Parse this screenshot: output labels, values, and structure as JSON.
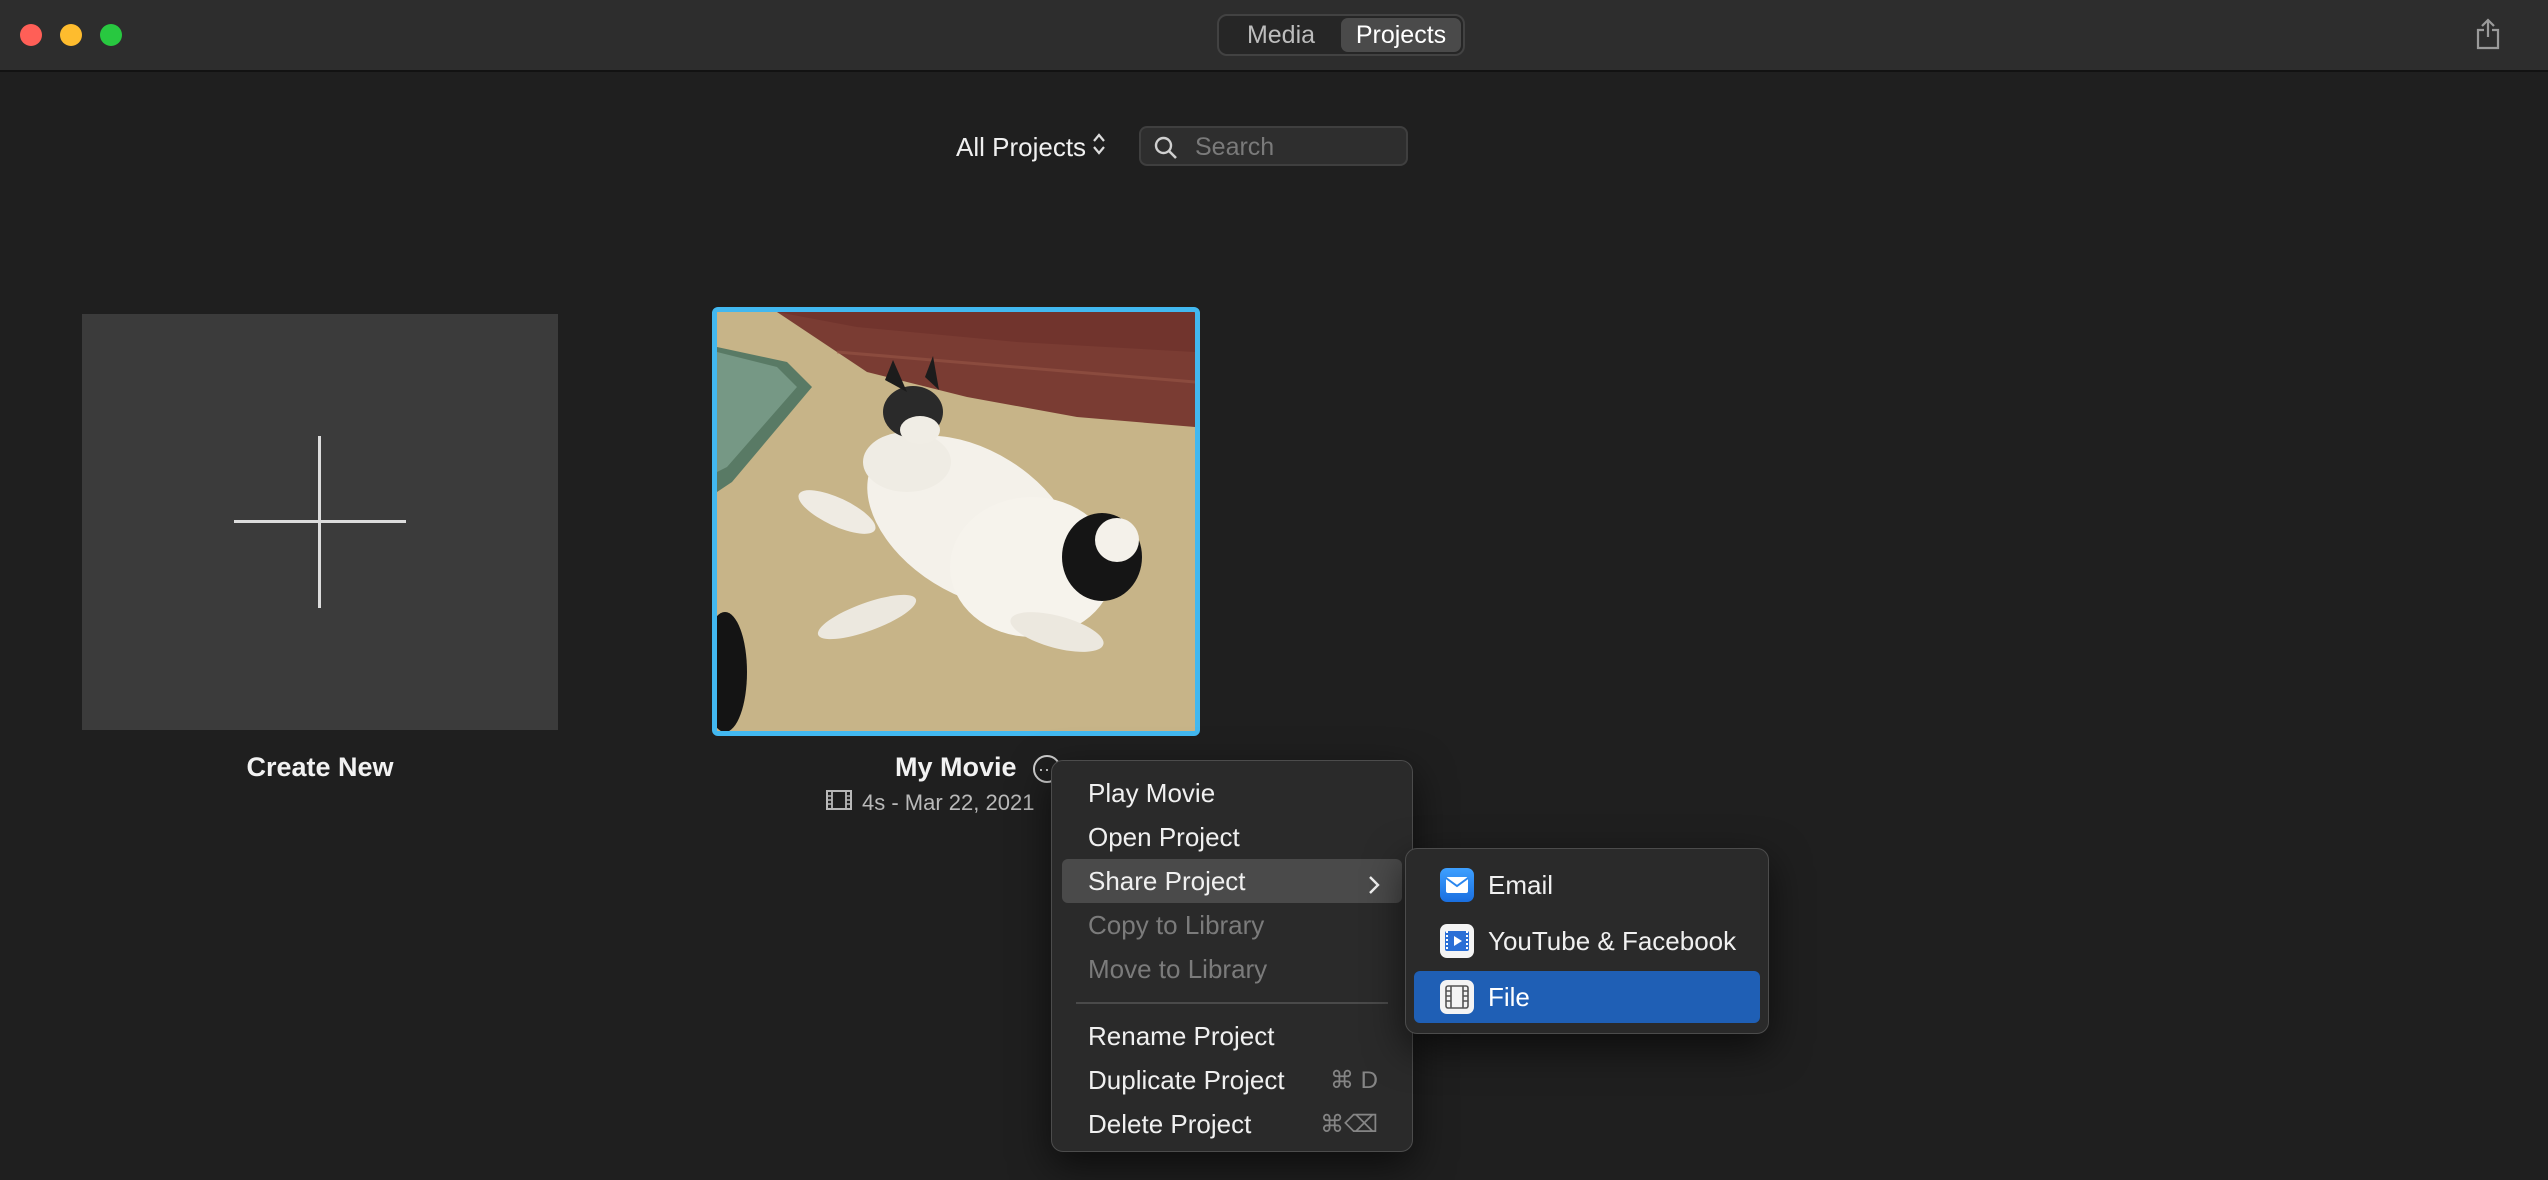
{
  "titlebar": {
    "tabs": [
      {
        "label": "Media",
        "active": false
      },
      {
        "label": "Projects",
        "active": true
      }
    ]
  },
  "toolbar": {
    "filter_label": "All Projects",
    "search_placeholder": "Search"
  },
  "projects": {
    "create_new_label": "Create New",
    "movie": {
      "title": "My Movie",
      "meta": "4s - Mar 22, 2021"
    }
  },
  "context_menu": {
    "items": [
      {
        "label": "Play Movie",
        "enabled": true
      },
      {
        "label": "Open Project",
        "enabled": true
      },
      {
        "label": "Share Project",
        "enabled": true,
        "submenu": true,
        "highlighted": true
      },
      {
        "label": "Copy to Library",
        "enabled": false
      },
      {
        "label": "Move to Library",
        "enabled": false
      },
      {
        "label": "Rename Project",
        "enabled": true
      },
      {
        "label": "Duplicate Project",
        "enabled": true,
        "shortcut": "⌘ D"
      },
      {
        "label": "Delete Project",
        "enabled": true,
        "shortcut": "⌘⌫"
      }
    ]
  },
  "share_submenu": {
    "items": [
      {
        "label": "Email",
        "icon": "mail-icon"
      },
      {
        "label": "YouTube & Facebook",
        "icon": "video-share-icon"
      },
      {
        "label": "File",
        "icon": "film-file-icon",
        "selected": true
      }
    ]
  },
  "colors": {
    "selection_blue": "#1f5fb5",
    "thumbnail_border": "#42b8f0"
  }
}
